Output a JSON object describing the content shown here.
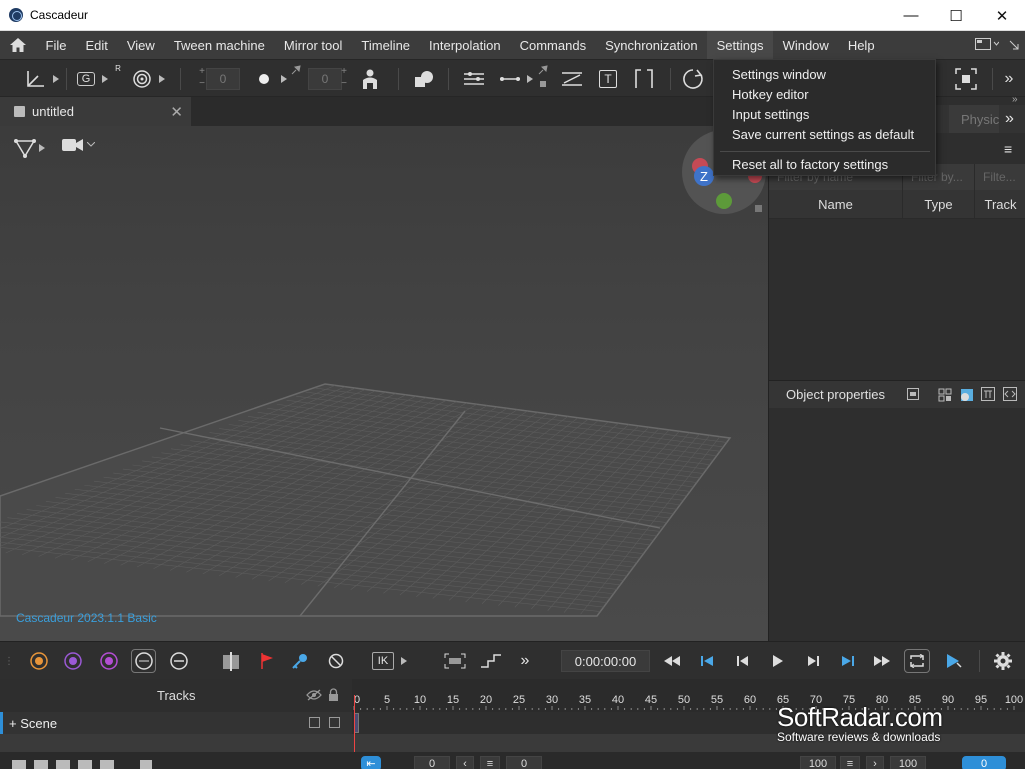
{
  "window": {
    "title": "Cascadeur",
    "min": "—",
    "max": "☐",
    "close": "✕"
  },
  "menu": {
    "items": [
      "File",
      "Edit",
      "View",
      "Tween machine",
      "Mirror tool",
      "Timeline",
      "Interpolation",
      "Commands",
      "Synchronization",
      "Settings",
      "Window",
      "Help"
    ],
    "active": "Settings"
  },
  "toolbar": {
    "field_a": "0",
    "field_b": "0",
    "text_tool": "T",
    "g_label": "G",
    "r_label": "R"
  },
  "document": {
    "tab": "untitled",
    "close": "✕"
  },
  "viewport": {
    "version": "Cascadeur 2023.1.1 Basic",
    "gizmo_axis": "Z"
  },
  "settings_menu": {
    "items": [
      "Settings window",
      "Hotkey editor",
      "Input settings",
      "Save current settings as default",
      "Reset all to factory settings"
    ]
  },
  "right_panel": {
    "tab_partial": "Physic",
    "filters": [
      "Filter by name",
      "Filter by...",
      "Filte..."
    ],
    "columns": [
      "Name",
      "Type",
      "Track"
    ],
    "object_properties": "Object properties"
  },
  "timeline": {
    "time": "0:00:00:00",
    "tracks_label": "Tracks",
    "scene_label": "+ Scene",
    "ruler": [
      0,
      5,
      10,
      15,
      20,
      25,
      30,
      35,
      40,
      45,
      50,
      55,
      60,
      65,
      70,
      75,
      80,
      85,
      90,
      95,
      100
    ],
    "ik_label": "IK",
    "bottom": {
      "a": "0",
      "b": "0",
      "c": "100",
      "d": "100",
      "e": "0"
    }
  },
  "watermark": {
    "title": "SoftRadar.com",
    "subtitle": "Software reviews & downloads"
  },
  "colors": {
    "accent": "#2e8fd8",
    "playhead": "#e44444",
    "version_text": "#3a9fdc"
  }
}
